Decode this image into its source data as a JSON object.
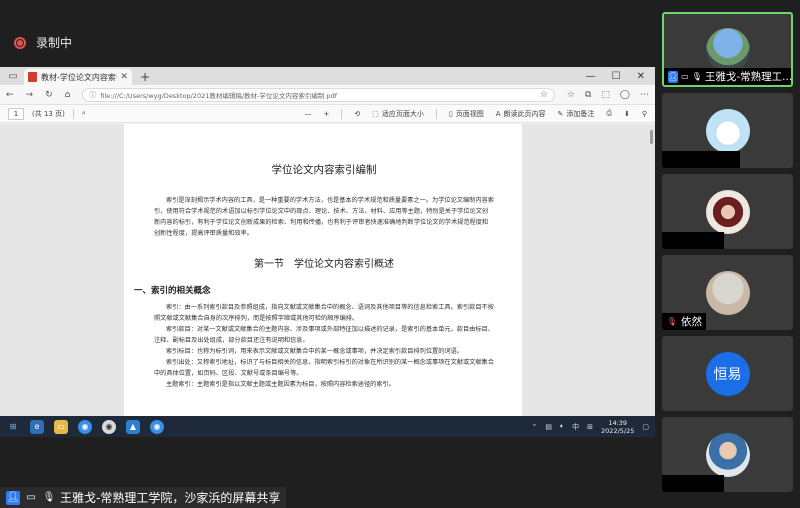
{
  "recording": {
    "label": "录制中"
  },
  "browser": {
    "tab_title": "教材-学位论文内容索引",
    "new_tab": "+",
    "url": "file:///C:/Users/wyg/Desktop/2021教材编辑稿/教材-学位论文内容索引编制.pdf",
    "controls": {
      "minimize": "—",
      "maximize": "☐",
      "close": "✕"
    }
  },
  "pdf_toolbar": {
    "page_current": "1",
    "page_total": "(共 13 页)",
    "zoom_out": "—",
    "zoom_in": "+",
    "fit_page": "适应页面大小",
    "page_view": "页面视图",
    "read_aloud": "朗读此页内容",
    "add_note": "添加备注"
  },
  "document": {
    "title": "学位论文内容索引编制",
    "intro": "索引是深刻揭示学术内容的工具，是一种重要的学术方法，也是基本的学术规范和质量要素之一。为学位论文编制内容索引，使用符合学术规范的术语加以标引学位论文中的观点、理论、技术、方法、材料、应用等主题，特别是关于学位论文创新内容的标引，有利于学位论文创新成果的检索、利用和传播，也有利于评审者快速准确地判断学位论文的学术规范程度和创新性程度，提高评审质量和效率。",
    "section": "第一节　学位论文内容索引概述",
    "heading1": "一、索引的相关概念",
    "p1": "索引：由一系列索引款目及参照组成，指向文献或文献集合中的概念、语词及其他项目等的信息检索工具。索引款目不按照文献或文献集合自身的次序排列，而是按照字顺或其他可检的顺序编排。",
    "p2": "索引款目：对某一文献或文献集合的主题内容、涉及事项或外部特征加以描述的记录，是索引的基本单元，款目由标目、注释、副标目及出处组成，部分款目还注有说明和信息。",
    "p3": "索引标目：也称为标引词，用来表示文献或文献集合中的某一概念或事项，并决定索引款目排列位置的词语。",
    "p4": "索引出处：又称索引地址，标识了与标目相关的信息，指明索引标引的对象在所识别的某一概念或事项在文献或文献集合中的具体位置，如页码、区段、文献号或条目编号等。",
    "p5": "主题索引：主题索引是指以文献主题或主题因素为标目，按照内容检索途径的索引。"
  },
  "taskbar": {
    "time": "14:39",
    "date": "2022/5/25",
    "ime": "中"
  },
  "share_caption": "王雅戈-常熟理工学院，沙家浜的屏幕共享",
  "participants": [
    {
      "name": "王雅戈-常熟理工...",
      "active": true
    },
    {
      "name": ""
    },
    {
      "name": ""
    },
    {
      "name": "依然"
    },
    {
      "name": "",
      "initials": "恒易"
    },
    {
      "name": ""
    }
  ]
}
